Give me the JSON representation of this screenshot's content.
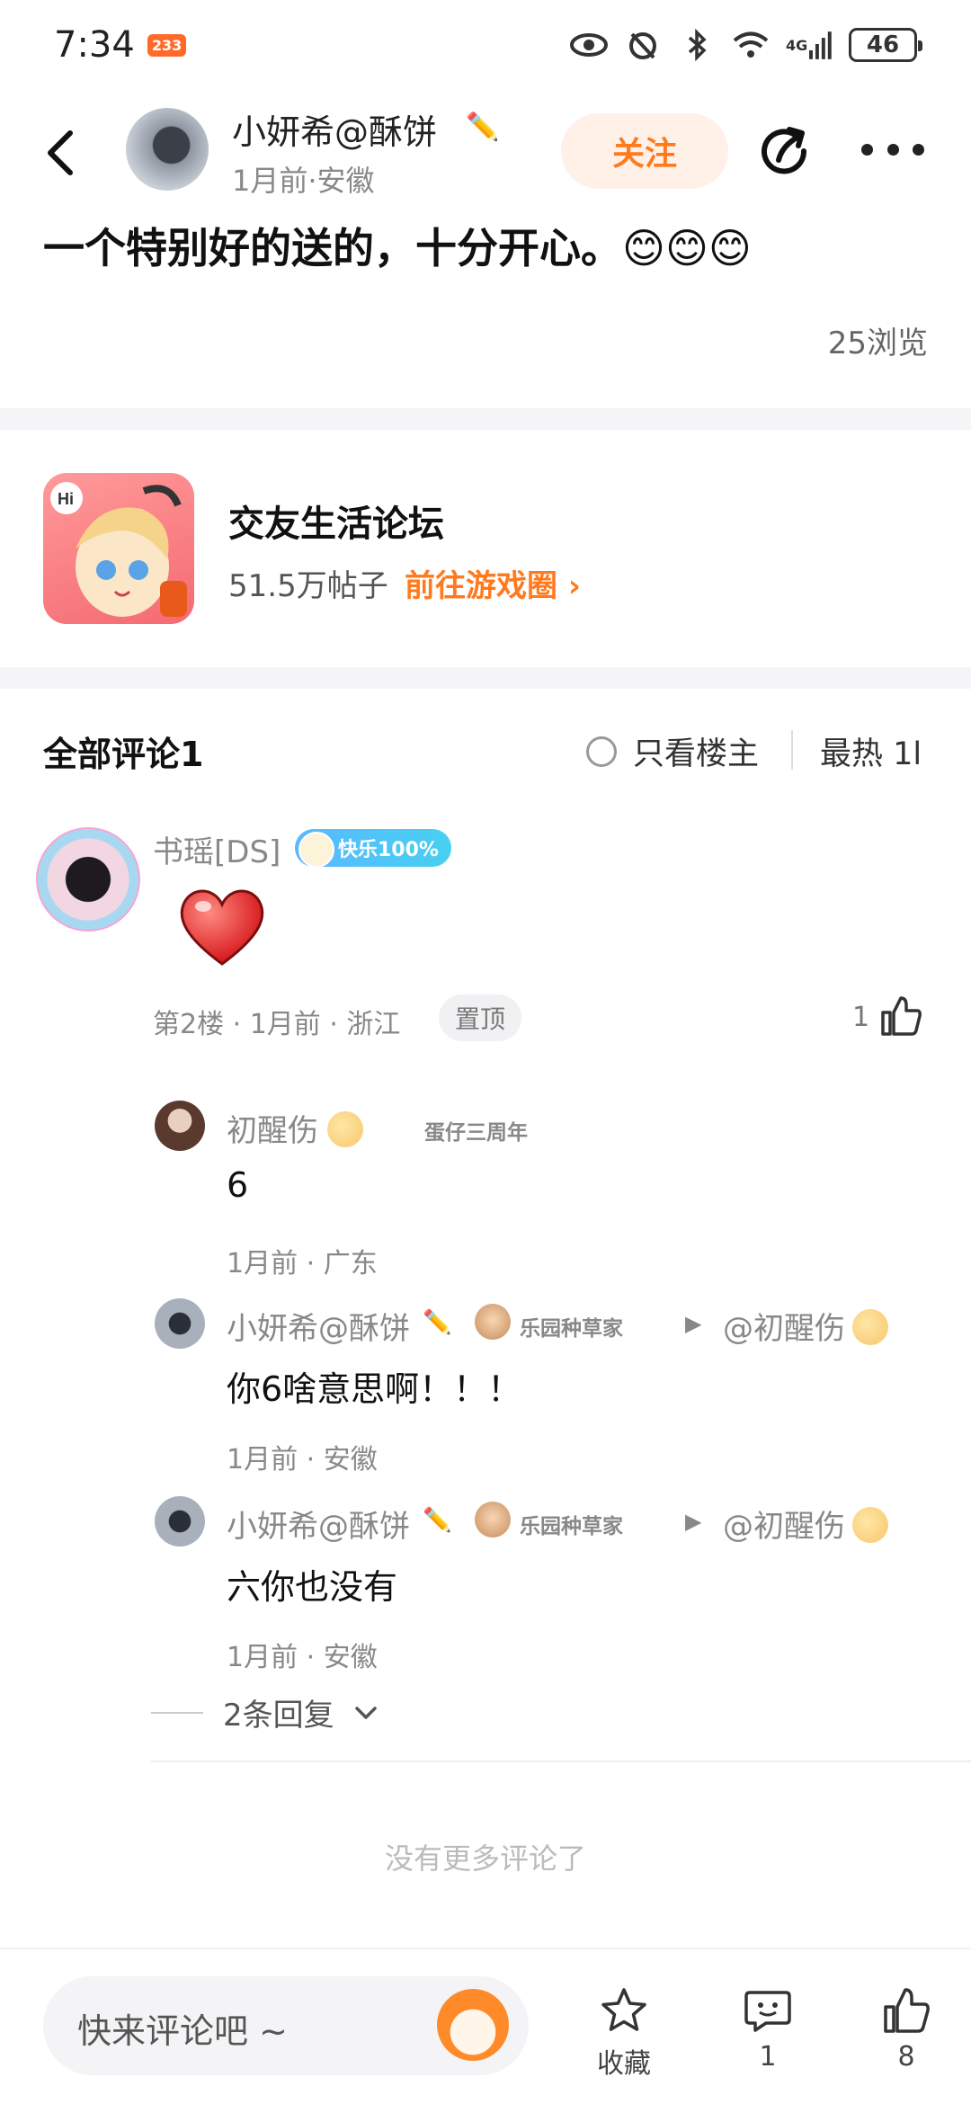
{
  "status_bar": {
    "time": "7:34",
    "badge": "233",
    "network": "4G",
    "battery": "46"
  },
  "header": {
    "author_name": "小妍希@酥饼",
    "author_meta": "1月前·安徽",
    "follow_label": "关注"
  },
  "post": {
    "text": "一个特别好的送的，十分开心。😊😊😊",
    "views": "25浏览"
  },
  "forum": {
    "name": "交友生活论坛",
    "posts": "51.5万帖子",
    "link": "前往游戏圈 ›"
  },
  "comments_header": {
    "title": "全部评论1",
    "only_host": "只看楼主",
    "sort": "最热 1l"
  },
  "comment": {
    "author": "书瑶[DS]",
    "badge": "快乐100%",
    "meta": "第2楼 · 1月前 · 浙江",
    "pin": "置顶",
    "likes": "1"
  },
  "replies": [
    {
      "author": "初醒伤",
      "badge": "蛋仔三周年",
      "text": "6",
      "meta": "1月前 · 广东"
    },
    {
      "author": "小妍希@酥饼",
      "badge": "乐园种草家",
      "target": "@初醒伤",
      "text": "你6啥意思啊！！！",
      "meta": "1月前 · 安徽"
    },
    {
      "author": "小妍希@酥饼",
      "badge": "乐园种草家",
      "target": "@初醒伤",
      "text": "六你也没有",
      "meta": "1月前 · 安徽"
    }
  ],
  "more_replies": "2条回复",
  "no_more": "没有更多评论了",
  "bottom_bar": {
    "input_placeholder": "快来评论吧 ~",
    "favorite_label": "收藏",
    "comment_count": "1",
    "like_count": "8"
  },
  "colors": {
    "accent": "#ff7a1e",
    "follow_bg": "#fff0e8"
  }
}
